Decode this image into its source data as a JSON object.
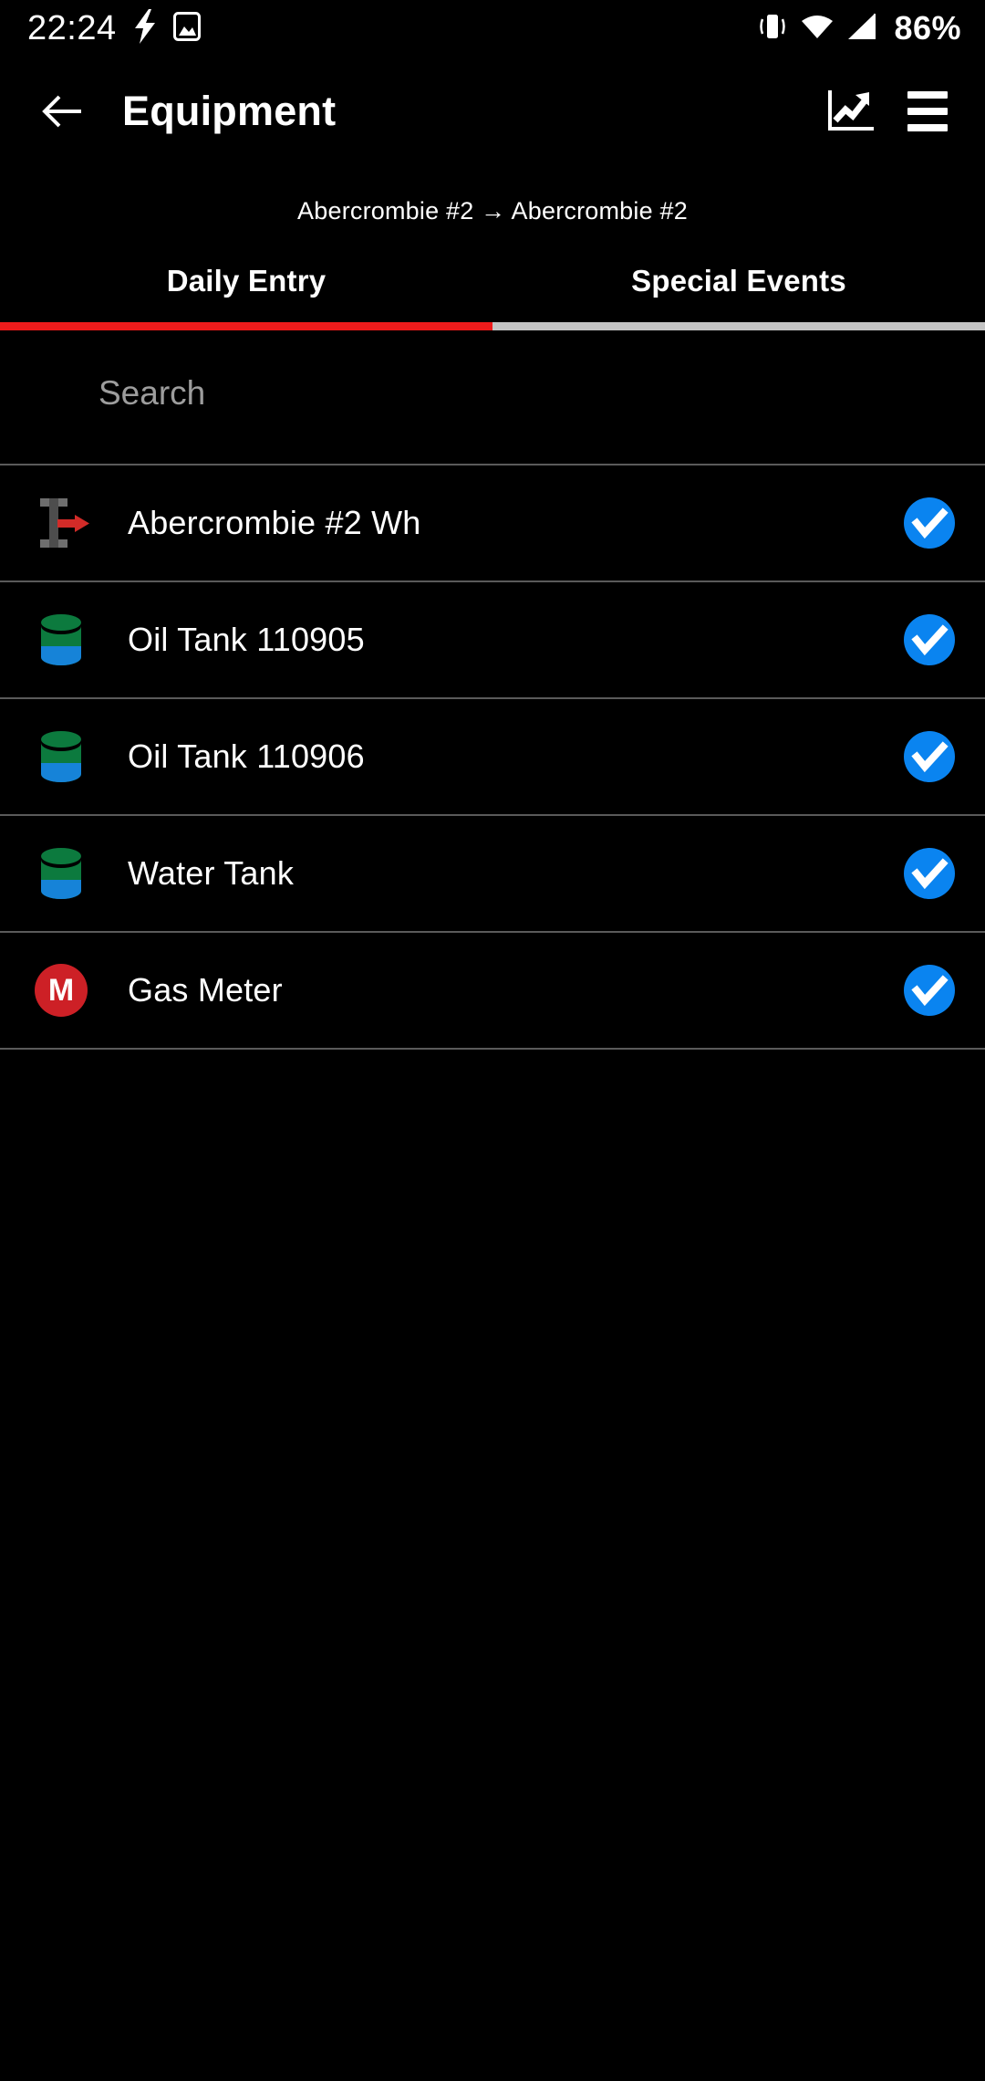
{
  "status_bar": {
    "clock": "22:24",
    "battery_percent": "86%",
    "left_icons": [
      "flash-bolt-icon",
      "image-icon"
    ],
    "right_icons": [
      "vibrate-icon",
      "wifi-icon",
      "cellular-signal-icon"
    ]
  },
  "app_bar": {
    "back_icon": "back-arrow-icon",
    "title": "Equipment",
    "chart_icon": "trending-chart-icon",
    "menu_icon": "hamburger-menu-icon"
  },
  "breadcrumb": {
    "text": "Abercrombie #2 → Abercrombie #2",
    "parent": "Abercrombie #2",
    "current": "Abercrombie #2"
  },
  "tabs": {
    "active_index": 0,
    "items": [
      {
        "label": "Daily Entry",
        "active": true
      },
      {
        "label": "Special Events",
        "active": false
      }
    ]
  },
  "search": {
    "placeholder": "Search",
    "value": ""
  },
  "equipment_list": {
    "rows": [
      {
        "label": "Abercrombie #2 Wh",
        "icon": "wellhead-icon",
        "checked": true
      },
      {
        "label": "Oil Tank 110905",
        "icon": "tank-icon",
        "checked": true
      },
      {
        "label": "Oil Tank 110906",
        "icon": "tank-icon",
        "checked": true
      },
      {
        "label": "Water Tank",
        "icon": "tank-icon",
        "checked": true
      },
      {
        "label": "Gas Meter",
        "icon": "meter-badge-icon",
        "badge_letter": "M",
        "checked": true
      }
    ]
  },
  "colors": {
    "background": "#000000",
    "accent_red": "#ee1b1b",
    "tab_inactive_underline": "#c4c4c4",
    "check_blue": "#0a84f0",
    "tank_green": "#0c7a3e",
    "tank_blue": "#1683d8",
    "meter_red": "#cd2026",
    "divider": "#5a5a5a",
    "placeholder_gray": "#9d9d9d",
    "wellhead_gray": "#6e6e6e",
    "wellhead_arrow_red": "#d22b28"
  }
}
